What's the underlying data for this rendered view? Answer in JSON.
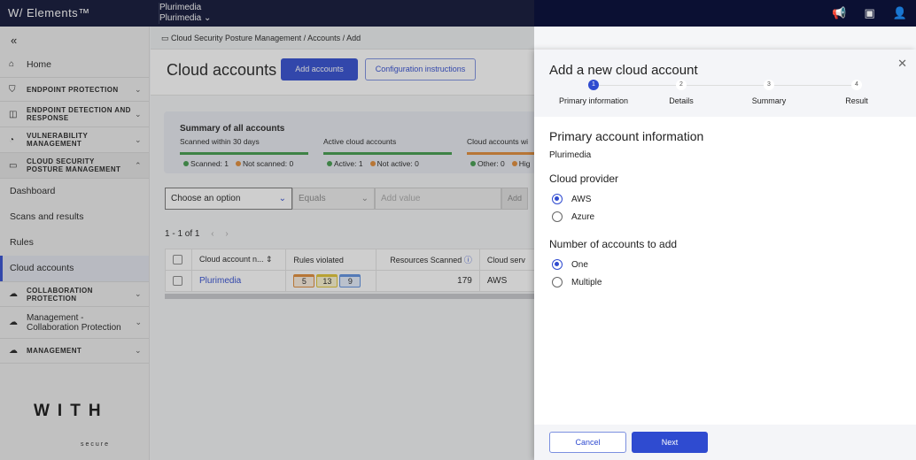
{
  "header": {
    "brand": "W/ Elements™",
    "org_line1": "Plurimedia",
    "org_line2": "Plurimedia ⌄"
  },
  "sidebar": {
    "collapse": "«",
    "home": "Home",
    "items": [
      {
        "label": "ENDPOINT PROTECTION"
      },
      {
        "label": "ENDPOINT DETECTION AND RESPONSE"
      },
      {
        "label": "VULNERABILITY MANAGEMENT"
      },
      {
        "label": "CLOUD SECURITY POSTURE MANAGEMENT"
      }
    ],
    "subitems": [
      "Dashboard",
      "Scans and results",
      "Rules",
      "Cloud accounts"
    ],
    "items2": [
      {
        "label": "COLLABORATION PROTECTION"
      },
      {
        "label": "Management - Collaboration Protection"
      },
      {
        "label": "MANAGEMENT"
      }
    ],
    "logo": "WITH",
    "logo_sub": "secure"
  },
  "breadcrumb": "Cloud Security Posture Management  /  Accounts  /  Add",
  "page": {
    "title": "Cloud accounts",
    "add_accounts": "Add accounts",
    "config": "Configuration instructions"
  },
  "summary": {
    "title": "Summary of all accounts",
    "cols": [
      {
        "label": "Scanned within 30 days",
        "a": "Scanned: 1",
        "b": "Not scanned: 0"
      },
      {
        "label": "Active cloud accounts",
        "a": "Active: 1",
        "b": "Not active: 0"
      },
      {
        "label": "Cloud accounts wi",
        "a": "Other: 0",
        "b": "Hig"
      }
    ]
  },
  "filter": {
    "field": "Choose an option",
    "op": "Equals",
    "placeholder": "Add value",
    "add": "Add"
  },
  "pager": "1 - 1 of 1",
  "table": {
    "headers": [
      "Cloud account n...",
      "Rules violated",
      "Resources Scanned",
      "Cloud serv"
    ],
    "rows": [
      {
        "name": "Plurimedia",
        "rules": [
          "5",
          "13",
          "9"
        ],
        "resources": "179",
        "service": "AWS"
      }
    ]
  },
  "panel": {
    "title": "Add a new cloud account",
    "steps": [
      {
        "n": "1",
        "label": "Primary information"
      },
      {
        "n": "2",
        "label": "Details"
      },
      {
        "n": "3",
        "label": "Summary"
      },
      {
        "n": "4",
        "label": "Result"
      }
    ],
    "section": "Primary account information",
    "org": "Plurimedia",
    "provider_label": "Cloud provider",
    "providers": [
      "AWS",
      "Azure"
    ],
    "count_label": "Number of accounts to add",
    "counts": [
      "One",
      "Multiple"
    ],
    "cancel": "Cancel",
    "next": "Next"
  }
}
